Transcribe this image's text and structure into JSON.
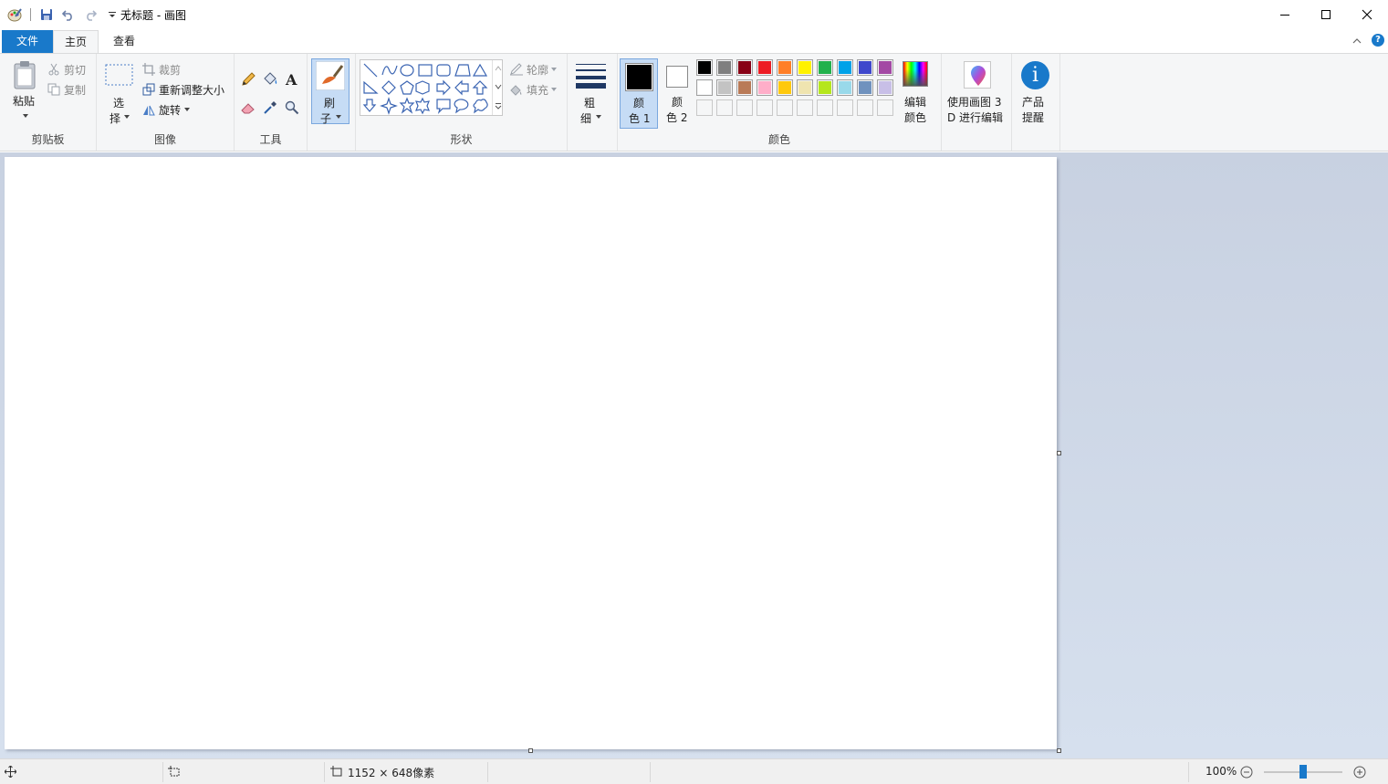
{
  "window": {
    "title": "无标题 - 画图",
    "minimize_icon": "minimize-icon",
    "maximize_icon": "maximize-icon",
    "close_icon": "close-icon"
  },
  "tabs": [
    {
      "label": "文件"
    },
    {
      "label": "主页"
    },
    {
      "label": "查看"
    }
  ],
  "clipboard": {
    "paste_label": "粘贴",
    "cut_label": "剪切",
    "copy_label": "复制",
    "group_label": "剪贴板"
  },
  "image": {
    "select_label_1": "选",
    "select_label_2": "择",
    "crop_label": "裁剪",
    "resize_label": "重新调整大小",
    "rotate_label": "旋转",
    "group_label": "图像"
  },
  "tools": {
    "group_label": "工具"
  },
  "brushes": {
    "label_1": "刷",
    "label_2": "子"
  },
  "shapes": {
    "outline_label": "轮廓",
    "fill_label": "填充",
    "group_label": "形状"
  },
  "size": {
    "label_1": "粗",
    "label_2": "细"
  },
  "colors": {
    "color1_label_1": "颜",
    "color1_label_2": "色 1",
    "color2_label_1": "颜",
    "color2_label_2": "色 2",
    "edit_label_1": "编辑",
    "edit_label_2": "颜色",
    "group_label": "颜色",
    "color1_value": "#000000",
    "color2_value": "#ffffff",
    "palette_row1": [
      "#000000",
      "#7f7f7f",
      "#880015",
      "#ed1c24",
      "#ff7f27",
      "#fff200",
      "#22b14c",
      "#00a2e8",
      "#3f48cc",
      "#a349a4"
    ],
    "palette_row2": [
      "#ffffff",
      "#c3c3c3",
      "#b97a57",
      "#ffaec9",
      "#ffc90e",
      "#efe4b0",
      "#b5e61d",
      "#99d9ea",
      "#7092be",
      "#c8bfe7"
    ]
  },
  "paint3d": {
    "label_1": "使用画图 3",
    "label_2": "D 进行编辑"
  },
  "product_alert": {
    "label_1": "产品",
    "label_2": "提醒"
  },
  "help_label": "?",
  "statusbar": {
    "dimensions": "1152 × 648像素",
    "zoom": "100%",
    "zoom_level": 0.5
  }
}
